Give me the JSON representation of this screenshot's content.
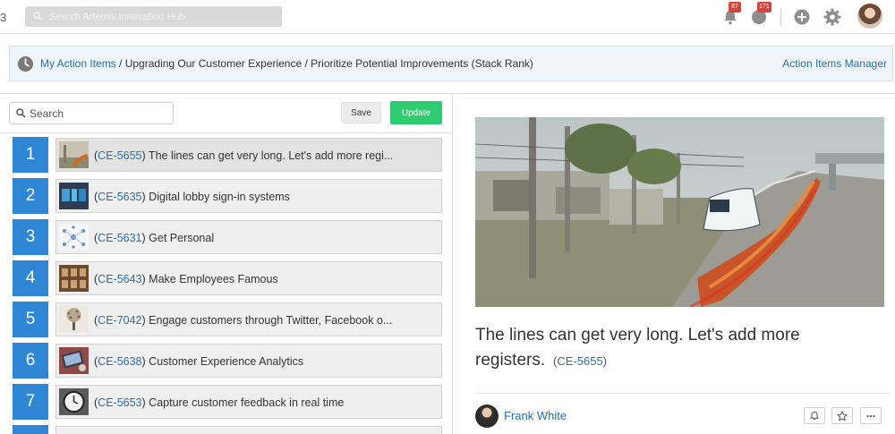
{
  "topbar": {
    "edge_glyph": "3",
    "search_placeholder": "Search Artemis Innovation Hub",
    "notifications_count": "87",
    "messages_count": "171"
  },
  "breadcrumb": {
    "root": "My Action Items",
    "sep1": " / ",
    "level2": "Upgrading Our Customer Experience",
    "sep2": " / ",
    "level3": "Prioritize Potential Improvements (Stack Rank)",
    "manager_link": "Action Items Manager"
  },
  "toolbar": {
    "search_placeholder": "Search",
    "save_label": "Save",
    "update_label": "Update"
  },
  "items": [
    {
      "rank": "1",
      "open": "(",
      "id": "CE-5655",
      "close": ")",
      "title": " The lines can get very long. Let's add more regi..."
    },
    {
      "rank": "2",
      "open": "(",
      "id": "CE-5635",
      "close": ")",
      "title": " Digital lobby sign-in systems"
    },
    {
      "rank": "3",
      "open": "(",
      "id": "CE-5631",
      "close": ")",
      "title": " Get Personal"
    },
    {
      "rank": "4",
      "open": "(",
      "id": "CE-5643",
      "close": ")",
      "title": " Make Employees Famous"
    },
    {
      "rank": "5",
      "open": "(",
      "id": "CE-7042",
      "close": ")",
      "title": " Engage customers through Twitter, Facebook o..."
    },
    {
      "rank": "6",
      "open": "(",
      "id": "CE-5638",
      "close": ")",
      "title": " Customer Experience Analytics"
    },
    {
      "rank": "7",
      "open": "(",
      "id": "CE-5653",
      "close": ")",
      "title": " Capture customer feedback in real time"
    }
  ],
  "detail": {
    "title": "The lines can get very long. Let's add more registers.",
    "id_open": "(",
    "id": "CE-5655",
    "id_close": ")",
    "owner": "Frank White"
  },
  "colors": {
    "rank_blue": "#2f86d4",
    "update_green": "#2ecc71",
    "link_blue": "#2a6fa8",
    "badge_red": "#d9443a"
  },
  "icons": [
    "search-icon",
    "bell-icon",
    "chat-icon",
    "plus-circle-icon",
    "gear-icon",
    "clock-icon",
    "bell-outline-icon",
    "star-icon",
    "more-icon"
  ]
}
